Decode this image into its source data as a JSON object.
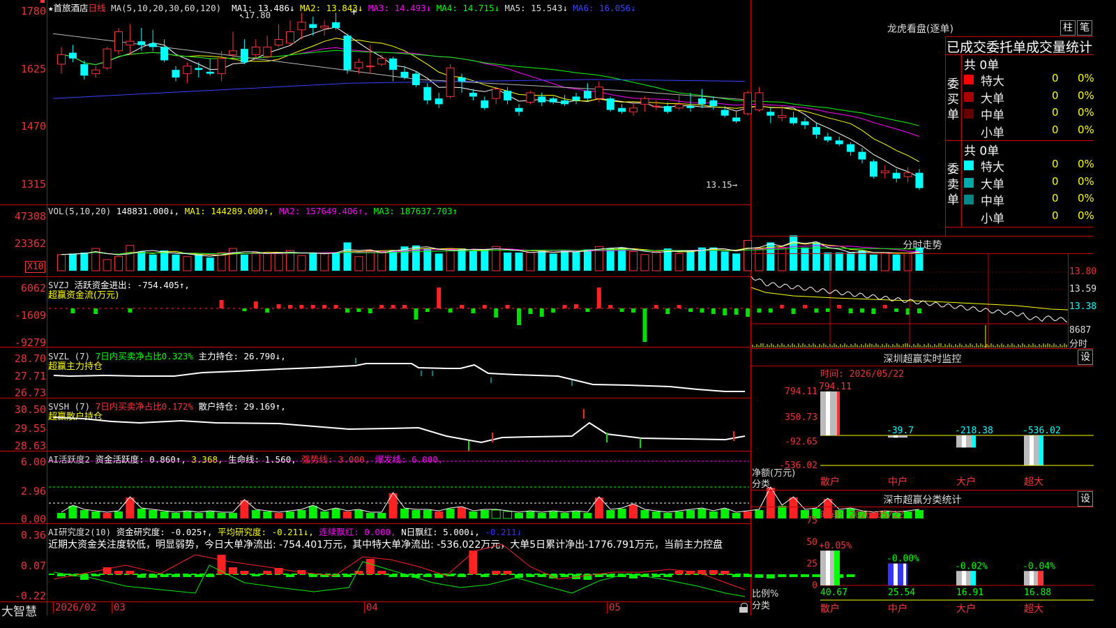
{
  "header": {
    "stock_name": "★首旅酒店",
    "period": "日线",
    "ma_params": "MA(5,10,20,30,60,120)",
    "ma_values": [
      {
        "label": "MA1: 13.486↓",
        "color": "#ffffff"
      },
      {
        "label": "MA2: 13.843↓",
        "color": "#ffff00"
      },
      {
        "label": "MA3: 14.493↓",
        "color": "#ff00ff"
      },
      {
        "label": "MA4: 14.715↓",
        "color": "#00ff00"
      },
      {
        "label": "MA5: 15.543↓",
        "color": "#dddddd"
      },
      {
        "label": "MA6: 16.056↓",
        "color": "#3344ff"
      }
    ],
    "high_mark": "17.80",
    "low_mark": "13.15"
  },
  "price_axis": [
    "1780",
    "1625",
    "1470",
    "1315"
  ],
  "volume": {
    "header": "VOL(5,10,20)",
    "value": "148831.000↓,",
    "ma1": "MA1: 144289.000↑,",
    "ma2": "MA2: 157649.406↑,",
    "ma3": "MA3: 187637.703↑",
    "axis": [
      "47308",
      "23362"
    ],
    "unit": "X10"
  },
  "svzj": {
    "header": "SVZJ",
    "desc": "活跃资金进出: -754.405↑,",
    "subtitle": "超赢资金流(万元)",
    "axis": [
      "6062",
      "-1609",
      "-9279"
    ]
  },
  "svzl": {
    "header": "SVZL (7)",
    "desc": "7日内买卖净占比0.323%",
    "extra": "主力持仓: 26.790↓,",
    "subtitle": "超赢主力持仓",
    "axis": [
      "28.70",
      "27.71",
      "26.73"
    ]
  },
  "svsh": {
    "header": "SVSH (7)",
    "desc": "7日内买卖净占比0.172%",
    "extra": "散户持仓: 29.169↑,",
    "subtitle": "超赢散户持仓",
    "axis": [
      "30.50",
      "29.55",
      "28.63"
    ]
  },
  "ai_active": {
    "header": "AI活跃度2",
    "desc": "资金活跃度: 0.860↑,",
    "v2": "3.368,",
    "life": "生命线: 1.560,",
    "strong": "强势线: 3.000,",
    "burst": "爆发线: 6.000,",
    "axis": [
      "6.00",
      "2.96",
      "0.00"
    ]
  },
  "ai_research": {
    "header": "AI研究度2(10)",
    "desc": "资金研究度: -0.025↑,",
    "avg": "平均研究度: -0.211↓,",
    "cont": "连续飘红: 0.000,",
    "nday": "N日飘红: 5.000↓,",
    "last": "-0.211↓",
    "comment": "近期大资金关注度较低，明显弱势，今日大单净流出: -754.401万元，其中特大单净流出: -536.022万元，大单5日累计净出-1776.791万元，当前主力控盘",
    "axis": [
      "0.36",
      "0.07",
      "-0.22"
    ]
  },
  "date_axis": {
    "brand": "大智慧",
    "labels": [
      "2026/02",
      "03",
      "04",
      "05"
    ]
  },
  "lhb": {
    "title": "龙虎看盘(逐单)",
    "btn1": "柱",
    "btn2": "笔",
    "subtitle": "已成交委托单成交量统计",
    "buy_label": "委买单",
    "sell_label": "委卖单",
    "buy_total": "共 0单",
    "sell_total": "共 0单",
    "buy_rows": [
      {
        "name": "特大",
        "count": "0",
        "pct": "0%",
        "color": "#ff0000"
      },
      {
        "name": "大单",
        "count": "0",
        "pct": "0%",
        "color": "#aa0000"
      },
      {
        "name": "中单",
        "count": "0",
        "pct": "0%",
        "color": "#660000"
      },
      {
        "name": "小单",
        "count": "0",
        "pct": "0%",
        "color": "#000000"
      }
    ],
    "sell_rows": [
      {
        "name": "特大",
        "count": "0",
        "pct": "0%",
        "color": "#00ffff"
      },
      {
        "name": "大单",
        "count": "0",
        "pct": "0%",
        "color": "#00aaaa"
      },
      {
        "name": "中单",
        "count": "0",
        "pct": "0%",
        "color": "#008888"
      },
      {
        "name": "小单",
        "count": "0",
        "pct": "0%",
        "color": "#000000"
      }
    ]
  },
  "intraday": {
    "title": "分时走势",
    "axis": [
      "13.80",
      "13.59",
      "13.38"
    ],
    "vol": "8687",
    "vol_label": "分时"
  },
  "sz_monitor": {
    "title": "深圳超赢实时监控",
    "settings": "设",
    "time": "时间: 2026/05/22",
    "axis": [
      "794.11",
      "350.73",
      "-92.65",
      "-536.02"
    ],
    "ylabel1": "净额(万元)",
    "ylabel2": "分类",
    "bars": [
      {
        "cat": "散户",
        "value": 794.11,
        "label": "794.11"
      },
      {
        "cat": "中户",
        "value": -39.7,
        "label": "-39.7"
      },
      {
        "cat": "大户",
        "value": -218.38,
        "label": "-218.38"
      },
      {
        "cat": "超大",
        "value": -536.02,
        "label": "-536.02"
      }
    ]
  },
  "sz_class": {
    "title": "深市超赢分类统计",
    "settings": "设",
    "time": "时间: 2026/05/22",
    "axis": [
      "75",
      "50",
      "25",
      "0"
    ],
    "ylabel1": "比例%",
    "ylabel2": "分类",
    "bars": [
      {
        "cat": "散户",
        "value": 40.67,
        "label": "40.67",
        "change": "+0.05%",
        "color": "#00ff00"
      },
      {
        "cat": "中户",
        "value": 25.54,
        "label": "25.54",
        "change": "-0.00%",
        "color": "#3333ff"
      },
      {
        "cat": "大户",
        "value": 16.91,
        "label": "16.91",
        "change": "-0.02%",
        "color": "#00ffff"
      },
      {
        "cat": "超大",
        "value": 16.88,
        "label": "16.88",
        "change": "-0.04%",
        "color": "#ff3333"
      }
    ]
  },
  "chart_data": {
    "type": "candlestick",
    "title": "首旅酒店 日线",
    "ylim": [
      13.15,
      17.8
    ],
    "candles": [
      [
        16.45,
        16.7,
        16.9,
        16.2
      ],
      [
        16.75,
        16.6,
        16.95,
        16.5
      ],
      [
        16.45,
        16.15,
        16.55,
        16.05
      ],
      [
        16.2,
        16.3,
        16.4,
        16.1
      ],
      [
        16.35,
        16.85,
        16.9,
        16.3
      ],
      [
        16.8,
        17.3,
        17.4,
        16.7
      ],
      [
        16.95,
        17.05,
        17.5,
        16.7
      ],
      [
        17.05,
        16.95,
        17.4,
        16.8
      ],
      [
        17.0,
        16.9,
        17.35,
        16.8
      ],
      [
        16.9,
        16.55,
        17.1,
        16.5
      ],
      [
        16.3,
        16.1,
        16.4,
        16.0
      ],
      [
        16.2,
        16.4,
        16.5,
        15.95
      ],
      [
        16.35,
        16.3,
        16.5,
        16.1
      ],
      [
        16.25,
        16.2,
        16.6,
        16.15
      ],
      [
        16.2,
        16.6,
        16.8,
        16.0
      ],
      [
        16.7,
        16.8,
        17.3,
        16.6
      ],
      [
        16.85,
        16.5,
        17.1,
        16.45
      ],
      [
        16.7,
        16.9,
        17.1,
        16.6
      ],
      [
        16.65,
        16.9,
        17.2,
        16.6
      ],
      [
        16.95,
        17.1,
        17.5,
        16.9
      ],
      [
        17.0,
        17.3,
        17.6,
        16.95
      ],
      [
        17.35,
        17.55,
        17.8,
        17.1
      ],
      [
        17.5,
        17.4,
        17.7,
        17.2
      ],
      [
        17.4,
        17.45,
        17.6,
        17.2
      ],
      [
        17.55,
        17.4,
        17.8,
        17.35
      ],
      [
        17.2,
        16.3,
        17.25,
        16.2
      ],
      [
        16.35,
        16.5,
        16.6,
        16.2
      ],
      [
        16.4,
        16.4,
        16.95,
        16.2
      ],
      [
        16.45,
        16.6,
        16.7,
        16.4
      ],
      [
        16.6,
        16.3,
        16.65,
        16.0
      ],
      [
        16.25,
        16.1,
        16.4,
        16.05
      ],
      [
        16.2,
        15.9,
        16.25,
        15.85
      ],
      [
        15.85,
        15.5,
        15.95,
        15.4
      ],
      [
        15.55,
        15.4,
        15.7,
        15.3
      ],
      [
        15.6,
        16.35,
        16.45,
        15.55
      ],
      [
        16.1,
        16.0,
        16.2,
        15.7
      ],
      [
        15.7,
        15.6,
        15.8,
        15.5
      ],
      [
        15.5,
        15.3,
        15.6,
        15.25
      ],
      [
        15.55,
        15.8,
        15.85,
        15.4
      ],
      [
        15.75,
        15.5,
        15.85,
        15.4
      ],
      [
        15.3,
        15.2,
        15.4,
        15.1
      ],
      [
        15.45,
        15.7,
        15.75,
        15.4
      ],
      [
        15.6,
        15.45,
        15.7,
        15.35
      ],
      [
        15.55,
        15.45,
        15.6,
        15.4
      ],
      [
        15.5,
        15.4,
        15.65,
        15.35
      ],
      [
        15.6,
        15.5,
        15.7,
        15.4
      ],
      [
        15.75,
        15.55,
        15.95,
        15.5
      ],
      [
        15.55,
        15.85,
        16.0,
        15.45
      ],
      [
        15.55,
        15.25,
        15.6,
        15.2
      ],
      [
        15.3,
        15.2,
        15.4,
        15.15
      ],
      [
        15.2,
        15.3,
        15.45,
        15.1
      ],
      [
        15.4,
        15.55,
        15.6,
        15.2
      ],
      [
        15.35,
        15.35,
        15.5,
        15.25
      ],
      [
        15.35,
        15.2,
        15.45,
        15.15
      ],
      [
        15.3,
        15.4,
        15.65,
        15.25
      ],
      [
        15.35,
        15.3,
        15.7,
        15.2
      ],
      [
        15.55,
        15.4,
        15.8,
        15.3
      ],
      [
        15.5,
        15.35,
        15.6,
        15.25
      ],
      [
        15.25,
        15.1,
        15.35,
        15.05
      ],
      [
        15.05,
        14.95,
        15.2,
        14.9
      ],
      [
        15.15,
        15.7,
        15.75,
        15.1
      ],
      [
        15.25,
        15.7,
        15.85,
        15.2
      ],
      [
        15.2,
        15.1,
        15.3,
        14.9
      ],
      [
        15.05,
        15.1,
        15.35,
        14.95
      ],
      [
        15.05,
        14.9,
        15.2,
        14.85
      ],
      [
        14.95,
        14.85,
        15.05,
        14.75
      ],
      [
        14.8,
        14.6,
        14.9,
        14.5
      ],
      [
        14.55,
        14.45,
        14.65,
        14.4
      ],
      [
        14.45,
        14.35,
        14.55,
        14.3
      ],
      [
        14.35,
        14.15,
        14.4,
        14.05
      ],
      [
        14.15,
        13.95,
        14.25,
        13.85
      ],
      [
        13.9,
        13.5,
        13.95,
        13.45
      ],
      [
        13.6,
        13.65,
        13.8,
        13.45
      ],
      [
        13.6,
        13.45,
        13.7,
        13.35
      ],
      [
        13.5,
        13.6,
        13.75,
        13.35
      ],
      [
        13.6,
        13.2,
        13.7,
        13.15
      ]
    ],
    "volume": [
      40,
      41,
      42,
      46,
      35,
      38,
      49,
      43,
      40,
      44,
      40,
      38,
      40,
      37,
      42,
      46,
      40,
      42,
      41,
      42,
      44,
      39,
      42,
      41,
      42,
      52,
      38,
      44,
      43,
      44,
      48,
      49,
      46,
      41,
      46,
      46,
      44,
      45,
      48,
      42,
      42,
      42,
      44,
      41,
      44,
      43,
      45,
      48,
      46,
      47,
      43,
      40,
      43,
      46,
      41,
      44,
      47,
      47,
      43,
      41,
      54,
      46,
      52,
      47,
      59,
      47,
      52,
      42,
      42,
      42,
      44,
      40,
      42,
      40,
      41,
      47
    ],
    "xlabels": [
      "2026/02",
      "03",
      "04",
      "05"
    ]
  }
}
